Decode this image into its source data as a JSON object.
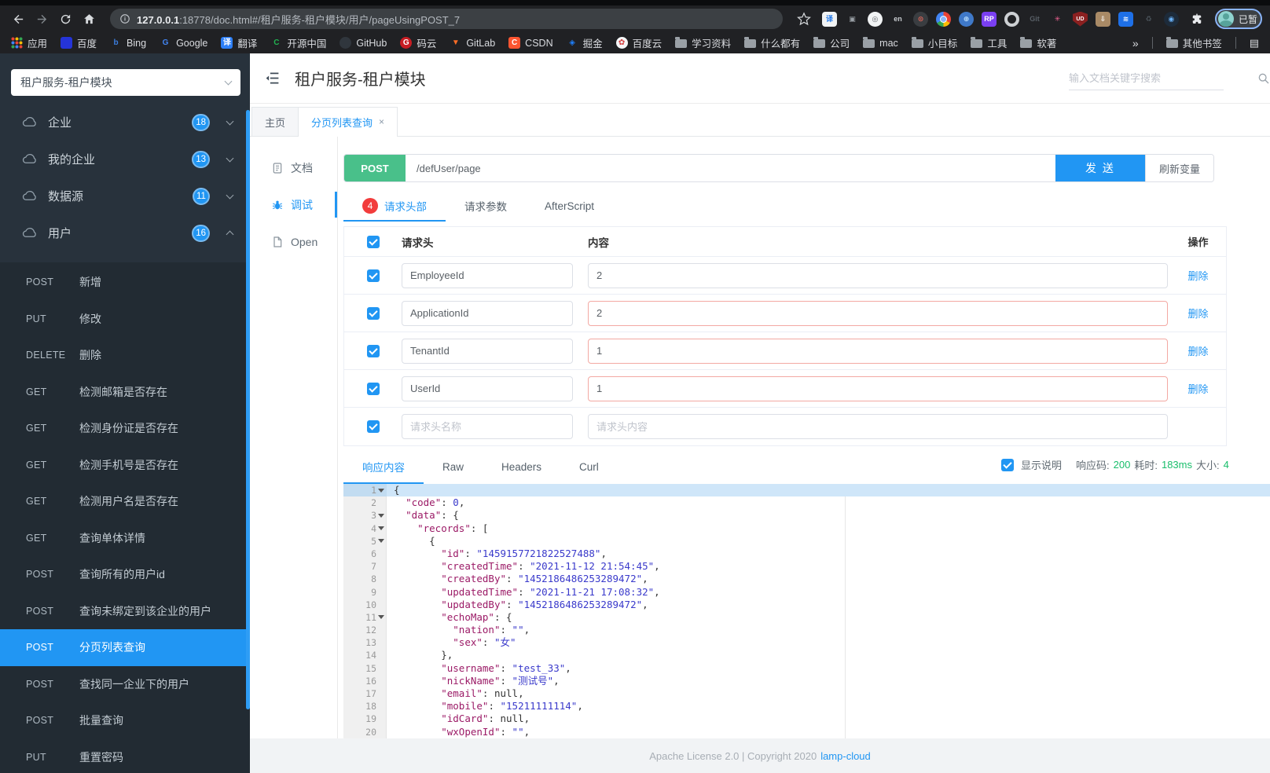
{
  "browser": {
    "url_host": "127.0.0.1",
    "url_rest": ":18778/doc.html#/租户服务-租户模块/用户/pageUsingPOST_7",
    "profile_label": "已暂",
    "overflow_glyph": "»",
    "readlist_glyph": "▤",
    "other_bookmarks": "其他书签",
    "toolbar_icons": [
      {
        "kind": "square",
        "bg": "#f1f3f4",
        "fg": "#1a73e8",
        "glyph": "译"
      },
      {
        "kind": "plain",
        "bg": "",
        "fg": "#9aa0a6",
        "glyph": "▣"
      },
      {
        "kind": "circle",
        "bg": "#f1f3f4",
        "fg": "#5f6368",
        "glyph": "◎"
      },
      {
        "kind": "plain",
        "bg": "",
        "fg": "#c8ccd0",
        "glyph": "en"
      },
      {
        "kind": "circle",
        "bg": "#3a3d41",
        "fg": "#e8675a",
        "glyph": "⊙"
      },
      {
        "kind": "chrome-ball",
        "bg": "",
        "fg": "",
        "glyph": ""
      },
      {
        "kind": "circle",
        "bg": "#3f79c9",
        "fg": "#bfe3ff",
        "glyph": "⊕"
      },
      {
        "kind": "square",
        "bg": "#7a3ff2",
        "fg": "#ffffff",
        "glyph": "RP"
      },
      {
        "kind": "ring",
        "bg": "",
        "fg": "",
        "glyph": ""
      },
      {
        "kind": "plain",
        "bg": "",
        "fg": "#585f66",
        "glyph": "Git"
      },
      {
        "kind": "plain",
        "bg": "",
        "fg": "#f06292",
        "glyph": "✳"
      },
      {
        "kind": "shield",
        "bg": "#8b2020",
        "fg": "#ffffff",
        "glyph": "UD"
      },
      {
        "kind": "square",
        "bg": "#a98a66",
        "fg": "#ffffff",
        "glyph": "⇩"
      },
      {
        "kind": "square",
        "bg": "#1e70e8",
        "fg": "#ffffff",
        "glyph": "≋"
      },
      {
        "kind": "plain",
        "bg": "",
        "fg": "#4d565e",
        "glyph": "♻"
      },
      {
        "kind": "circle",
        "bg": "#1d2b3a",
        "fg": "#6cb6ff",
        "glyph": "◉"
      }
    ],
    "bookmarks": [
      {
        "label": "应用",
        "icon": {
          "kind": "grid",
          "bg": "",
          "fg": "",
          "glyph": ""
        }
      },
      {
        "label": "百度",
        "icon": {
          "kind": "square",
          "bg": "#2534d8",
          "fg": "#ffffff",
          "glyph": ""
        }
      },
      {
        "label": "Bing",
        "icon": {
          "kind": "plain",
          "bg": "",
          "fg": "#3b7ddd",
          "glyph": "b"
        }
      },
      {
        "label": "Google",
        "icon": {
          "kind": "plain",
          "bg": "",
          "fg": "#4285f4",
          "glyph": "G"
        }
      },
      {
        "label": "翻译",
        "icon": {
          "kind": "square",
          "bg": "#2d7ff7",
          "fg": "#ffffff",
          "glyph": "译"
        }
      },
      {
        "label": "开源中国",
        "icon": {
          "kind": "plain",
          "bg": "",
          "fg": "#21b351",
          "glyph": "C"
        }
      },
      {
        "label": "GitHub",
        "icon": {
          "kind": "circle",
          "bg": "#30363d",
          "fg": "#ffffff",
          "glyph": ""
        }
      },
      {
        "label": "码云",
        "icon": {
          "kind": "circle",
          "bg": "#c71d23",
          "fg": "#ffffff",
          "glyph": "G"
        }
      },
      {
        "label": "GitLab",
        "icon": {
          "kind": "plain",
          "bg": "",
          "fg": "#fc6d26",
          "glyph": "▼"
        }
      },
      {
        "label": "CSDN",
        "icon": {
          "kind": "square",
          "bg": "#fc5531",
          "fg": "#ffffff",
          "glyph": "C"
        }
      },
      {
        "label": "掘金",
        "icon": {
          "kind": "plain",
          "bg": "",
          "fg": "#1e80ff",
          "glyph": "◈"
        }
      },
      {
        "label": "百度云",
        "icon": {
          "kind": "circle",
          "bg": "#f5f6f7",
          "fg": "#d43d3d",
          "glyph": "✿"
        }
      },
      {
        "label": "学习资料",
        "icon": {
          "kind": "folder",
          "bg": "",
          "fg": "",
          "glyph": ""
        }
      },
      {
        "label": "什么都有",
        "icon": {
          "kind": "folder",
          "bg": "",
          "fg": "",
          "glyph": ""
        }
      },
      {
        "label": "公司",
        "icon": {
          "kind": "folder",
          "bg": "",
          "fg": "",
          "glyph": ""
        }
      },
      {
        "label": "mac",
        "icon": {
          "kind": "folder",
          "bg": "",
          "fg": "",
          "glyph": ""
        }
      },
      {
        "label": "小目标",
        "icon": {
          "kind": "folder",
          "bg": "",
          "fg": "",
          "glyph": ""
        }
      },
      {
        "label": "工具",
        "icon": {
          "kind": "folder",
          "bg": "",
          "fg": "",
          "glyph": ""
        }
      },
      {
        "label": "软著",
        "icon": {
          "kind": "folder",
          "bg": "",
          "fg": "",
          "glyph": ""
        }
      }
    ]
  },
  "sidebar": {
    "service_select": "租户服务-租户模块",
    "groups": [
      {
        "label": "企业",
        "count": "18",
        "expanded": false
      },
      {
        "label": "我的企业",
        "count": "13",
        "expanded": false
      },
      {
        "label": "数据源",
        "count": "11",
        "expanded": false
      },
      {
        "label": "用户",
        "count": "16",
        "expanded": true
      }
    ],
    "items": [
      {
        "method": "POST",
        "label": "新增",
        "active": false
      },
      {
        "method": "PUT",
        "label": "修改",
        "active": false
      },
      {
        "method": "DELETE",
        "label": "删除",
        "active": false
      },
      {
        "method": "GET",
        "label": "检测邮箱是否存在",
        "active": false
      },
      {
        "method": "GET",
        "label": "检测身份证是否存在",
        "active": false
      },
      {
        "method": "GET",
        "label": "检测手机号是否存在",
        "active": false
      },
      {
        "method": "GET",
        "label": "检测用户名是否存在",
        "active": false
      },
      {
        "method": "GET",
        "label": "查询单体详情",
        "active": false
      },
      {
        "method": "POST",
        "label": "查询所有的用户id",
        "active": false
      },
      {
        "method": "POST",
        "label": "查询未绑定到该企业的用户",
        "active": false
      },
      {
        "method": "POST",
        "label": "分页列表查询",
        "active": true
      },
      {
        "method": "POST",
        "label": "查找同一企业下的用户",
        "active": false
      },
      {
        "method": "POST",
        "label": "批量查询",
        "active": false
      },
      {
        "method": "PUT",
        "label": "重置密码",
        "active": false
      }
    ]
  },
  "header": {
    "title": "租户服务-租户模块",
    "search_placeholder": "输入文档关键字搜索"
  },
  "tabs": [
    {
      "label": "主页",
      "active": false,
      "close": ""
    },
    {
      "label": "分页列表查询",
      "active": true,
      "close": "×"
    }
  ],
  "subnav": [
    {
      "label": "文档",
      "icon": "doc",
      "active": false
    },
    {
      "label": "调试",
      "icon": "bug",
      "active": true
    },
    {
      "label": "Open",
      "icon": "open",
      "active": false
    }
  ],
  "request": {
    "method": "POST",
    "url": "/defUser/page",
    "send_label": "发 送",
    "refresh_label": "刷新变量",
    "tabs": [
      {
        "label": "请求头部",
        "badge": "4",
        "active": true
      },
      {
        "label": "请求参数",
        "badge": "",
        "active": false
      },
      {
        "label": "AfterScript",
        "badge": "",
        "active": false
      }
    ],
    "table": {
      "col_header": "请求头",
      "col_content": "内容",
      "col_action": "操作",
      "delete_label": "删除",
      "rows": [
        {
          "name": "EmployeeId",
          "value": "2",
          "invalid": false,
          "deletable": true,
          "name_ph": "",
          "value_ph": ""
        },
        {
          "name": "ApplicationId",
          "value": "2",
          "invalid": true,
          "deletable": true,
          "name_ph": "",
          "value_ph": ""
        },
        {
          "name": "TenantId",
          "value": "1",
          "invalid": true,
          "deletable": true,
          "name_ph": "",
          "value_ph": ""
        },
        {
          "name": "UserId",
          "value": "1",
          "invalid": true,
          "deletable": true,
          "name_ph": "",
          "value_ph": ""
        },
        {
          "name": "",
          "value": "",
          "invalid": false,
          "deletable": false,
          "name_ph": "请求头名称",
          "value_ph": "请求头内容"
        }
      ]
    }
  },
  "response": {
    "tabs": [
      {
        "label": "响应内容",
        "active": true
      },
      {
        "label": "Raw",
        "active": false
      },
      {
        "label": "Headers",
        "active": false
      },
      {
        "label": "Curl",
        "active": false
      }
    ],
    "meta": {
      "show_desc": "显示说明",
      "code_label": "响应码:",
      "code": "200",
      "time_label": "耗时:",
      "time": "183ms",
      "size_label": "大小:",
      "size": "4"
    },
    "code_lines": [
      {
        "n": "1",
        "fold": true,
        "active": true,
        "segs": [
          [
            "p",
            "{"
          ]
        ]
      },
      {
        "n": "2",
        "fold": false,
        "active": false,
        "segs": [
          [
            "p",
            "  "
          ],
          [
            "k",
            "\"code\""
          ],
          [
            "p",
            ": "
          ],
          [
            "v",
            "0"
          ],
          [
            "p",
            ","
          ]
        ]
      },
      {
        "n": "3",
        "fold": true,
        "active": false,
        "segs": [
          [
            "p",
            "  "
          ],
          [
            "k",
            "\"data\""
          ],
          [
            "p",
            ": {"
          ]
        ]
      },
      {
        "n": "4",
        "fold": true,
        "active": false,
        "segs": [
          [
            "p",
            "    "
          ],
          [
            "k",
            "\"records\""
          ],
          [
            "p",
            ": ["
          ]
        ]
      },
      {
        "n": "5",
        "fold": true,
        "active": false,
        "segs": [
          [
            "p",
            "      {"
          ]
        ]
      },
      {
        "n": "6",
        "fold": false,
        "active": false,
        "segs": [
          [
            "p",
            "        "
          ],
          [
            "k",
            "\"id\""
          ],
          [
            "p",
            ": "
          ],
          [
            "s",
            "\"1459157721822527488\""
          ],
          [
            "p",
            ","
          ]
        ]
      },
      {
        "n": "7",
        "fold": false,
        "active": false,
        "segs": [
          [
            "p",
            "        "
          ],
          [
            "k",
            "\"createdTime\""
          ],
          [
            "p",
            ": "
          ],
          [
            "s",
            "\"2021-11-12 21:54:45\""
          ],
          [
            "p",
            ","
          ]
        ]
      },
      {
        "n": "8",
        "fold": false,
        "active": false,
        "segs": [
          [
            "p",
            "        "
          ],
          [
            "k",
            "\"createdBy\""
          ],
          [
            "p",
            ": "
          ],
          [
            "s",
            "\"1452186486253289472\""
          ],
          [
            "p",
            ","
          ]
        ]
      },
      {
        "n": "9",
        "fold": false,
        "active": false,
        "segs": [
          [
            "p",
            "        "
          ],
          [
            "k",
            "\"updatedTime\""
          ],
          [
            "p",
            ": "
          ],
          [
            "s",
            "\"2021-11-21 17:08:32\""
          ],
          [
            "p",
            ","
          ]
        ]
      },
      {
        "n": "10",
        "fold": false,
        "active": false,
        "segs": [
          [
            "p",
            "        "
          ],
          [
            "k",
            "\"updatedBy\""
          ],
          [
            "p",
            ": "
          ],
          [
            "s",
            "\"1452186486253289472\""
          ],
          [
            "p",
            ","
          ]
        ]
      },
      {
        "n": "11",
        "fold": true,
        "active": false,
        "segs": [
          [
            "p",
            "        "
          ],
          [
            "k",
            "\"echoMap\""
          ],
          [
            "p",
            ": {"
          ]
        ]
      },
      {
        "n": "12",
        "fold": false,
        "active": false,
        "segs": [
          [
            "p",
            "          "
          ],
          [
            "k",
            "\"nation\""
          ],
          [
            "p",
            ": "
          ],
          [
            "s",
            "\"\""
          ],
          [
            "p",
            ","
          ]
        ]
      },
      {
        "n": "13",
        "fold": false,
        "active": false,
        "segs": [
          [
            "p",
            "          "
          ],
          [
            "k",
            "\"sex\""
          ],
          [
            "p",
            ": "
          ],
          [
            "s",
            "\"女\""
          ]
        ]
      },
      {
        "n": "14",
        "fold": false,
        "active": false,
        "segs": [
          [
            "p",
            "        },"
          ]
        ]
      },
      {
        "n": "15",
        "fold": false,
        "active": false,
        "segs": [
          [
            "p",
            "        "
          ],
          [
            "k",
            "\"username\""
          ],
          [
            "p",
            ": "
          ],
          [
            "s",
            "\"test_33\""
          ],
          [
            "p",
            ","
          ]
        ]
      },
      {
        "n": "16",
        "fold": false,
        "active": false,
        "segs": [
          [
            "p",
            "        "
          ],
          [
            "k",
            "\"nickName\""
          ],
          [
            "p",
            ": "
          ],
          [
            "s",
            "\"测试号\""
          ],
          [
            "p",
            ","
          ]
        ]
      },
      {
        "n": "17",
        "fold": false,
        "active": false,
        "segs": [
          [
            "p",
            "        "
          ],
          [
            "k",
            "\"email\""
          ],
          [
            "p",
            ": "
          ],
          [
            "n",
            "null"
          ],
          [
            "p",
            ","
          ]
        ]
      },
      {
        "n": "18",
        "fold": false,
        "active": false,
        "segs": [
          [
            "p",
            "        "
          ],
          [
            "k",
            "\"mobile\""
          ],
          [
            "p",
            ": "
          ],
          [
            "s",
            "\"15211111114\""
          ],
          [
            "p",
            ","
          ]
        ]
      },
      {
        "n": "19",
        "fold": false,
        "active": false,
        "segs": [
          [
            "p",
            "        "
          ],
          [
            "k",
            "\"idCard\""
          ],
          [
            "p",
            ": "
          ],
          [
            "n",
            "null"
          ],
          [
            "p",
            ","
          ]
        ]
      },
      {
        "n": "20",
        "fold": false,
        "active": false,
        "segs": [
          [
            "p",
            "        "
          ],
          [
            "k",
            "\"wxOpenId\""
          ],
          [
            "p",
            ": "
          ],
          [
            "s",
            "\"\""
          ],
          [
            "p",
            ","
          ]
        ]
      }
    ]
  },
  "footer": {
    "text": "Apache License 2.0 | Copyright 2020",
    "link": "lamp-cloud"
  }
}
